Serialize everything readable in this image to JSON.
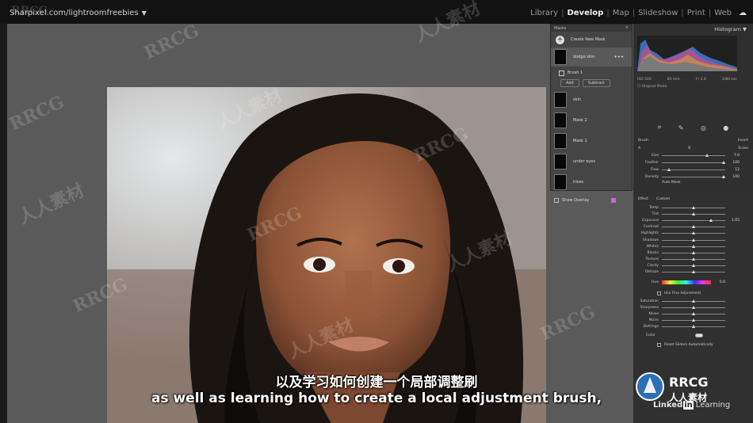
{
  "topbar": {
    "brand": "Sharpixel.com/lightroomfreebies",
    "modules": [
      "Library",
      "Develop",
      "Map",
      "Slideshow",
      "Print",
      "Web"
    ],
    "active_module": "Develop"
  },
  "masks_panel": {
    "title": "Masks",
    "create_label": "Create New Mask",
    "items": [
      {
        "label": "dodge skin",
        "selected": true
      },
      {
        "label": "skin"
      },
      {
        "label": "Mask 2"
      },
      {
        "label": "Mask 1"
      },
      {
        "label": "under eyes"
      },
      {
        "label": "irises"
      }
    ],
    "brush_label": "Brush 1",
    "add_label": "Add",
    "subtract_label": "Subtract",
    "show_overlay": "Show Overlay",
    "overlay_color": "#c26bd4"
  },
  "histogram": {
    "title": "Histogram",
    "iso": "ISO 500",
    "focal": "85 mm",
    "aperture": "f / 2.8",
    "shutter": "1/80 sec",
    "original_photo": "Original Photo"
  },
  "brush": {
    "title": "Brush",
    "invert": "Invert",
    "a_label": "A",
    "b_label": "B",
    "erase_label": "Erase",
    "sliders": [
      {
        "label": "Size",
        "value": "7.0",
        "pos": 0.72
      },
      {
        "label": "Feather",
        "value": "100",
        "pos": 0.98
      },
      {
        "label": "Flow",
        "value": "12",
        "pos": 0.12
      },
      {
        "label": "Density",
        "value": "100",
        "pos": 0.98
      }
    ],
    "auto_mask": "Auto Mask"
  },
  "effect": {
    "title": "Effect",
    "preset": "Custom",
    "sliders_top": [
      {
        "label": "Temp",
        "pos": 0.5
      },
      {
        "label": "Tint",
        "pos": 0.5
      },
      {
        "label": "Exposure",
        "pos": 0.78,
        "value": "1.65"
      },
      {
        "label": "Contrast",
        "pos": 0.5
      },
      {
        "label": "Highlights",
        "pos": 0.5
      },
      {
        "label": "Shadows",
        "pos": 0.5
      },
      {
        "label": "Whites",
        "pos": 0.5
      },
      {
        "label": "Blacks",
        "pos": 0.5
      },
      {
        "label": "Texture",
        "pos": 0.5
      },
      {
        "label": "Clarity",
        "pos": 0.5
      },
      {
        "label": "Dehaze",
        "pos": 0.5
      }
    ],
    "hue_label": "Hue",
    "hue_value": "0.0",
    "fine_adjust": "Use Fine Adjustment",
    "sliders_bottom": [
      {
        "label": "Saturation",
        "pos": 0.5
      },
      {
        "label": "Sharpness",
        "pos": 0.5
      },
      {
        "label": "Noise",
        "pos": 0.5
      },
      {
        "label": "Moire",
        "pos": 0.5
      },
      {
        "label": "Defringe",
        "pos": 0.5
      }
    ],
    "color_label": "Color",
    "reset_label": "Reset Sliders Automatically"
  },
  "subtitles": {
    "chinese": "以及学习如何创建一个局部调整刷",
    "english": "as well as learning how to create a local adjustment brush,"
  },
  "watermark": {
    "brand": "RRCG",
    "cn": "人人素材"
  },
  "linkedin": {
    "brand": "Linked",
    "in": "in",
    "learning": "Learning"
  }
}
